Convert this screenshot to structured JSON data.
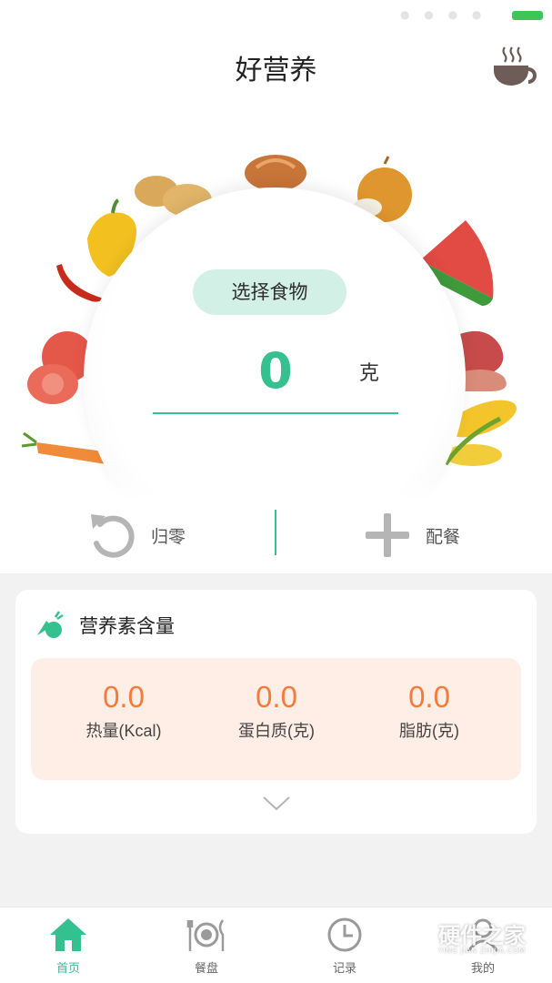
{
  "colors": {
    "accent": "#34c08f",
    "accent_light": "#d3f0e6",
    "stat_orange": "#f47b3c",
    "stat_panel": "#ffeee6",
    "icon_gray": "#b5b5b5",
    "battery": "#3bc65a"
  },
  "header": {
    "title": "好营养",
    "cup_icon": "coffee-cup-icon"
  },
  "scale": {
    "select_food_label": "选择食物",
    "amount": "0",
    "unit": "克"
  },
  "actions": {
    "reset_label": "归零",
    "reset_icon": "rotate-left-icon",
    "meal_label": "配餐",
    "meal_icon": "plus-icon"
  },
  "nutrition": {
    "title": "营养素含量",
    "icon": "vegetables-icon",
    "items": [
      {
        "value": "0.0",
        "label": "热量(Kcal)"
      },
      {
        "value": "0.0",
        "label": "蛋白质(克)"
      },
      {
        "value": "0.0",
        "label": "脂肪(克)"
      }
    ],
    "expand_icon": "chevron-down-icon"
  },
  "tabs": [
    {
      "label": "首页",
      "icon": "home-icon",
      "active": true
    },
    {
      "label": "餐盘",
      "icon": "dinner-plate-icon",
      "active": false
    },
    {
      "label": "记录",
      "icon": "clock-icon",
      "active": false
    },
    {
      "label": "我的",
      "icon": "user-icon",
      "active": false
    }
  ],
  "watermark": {
    "main": "硬件之家",
    "sub": "YING JIAN ZHIJIA.COM"
  }
}
